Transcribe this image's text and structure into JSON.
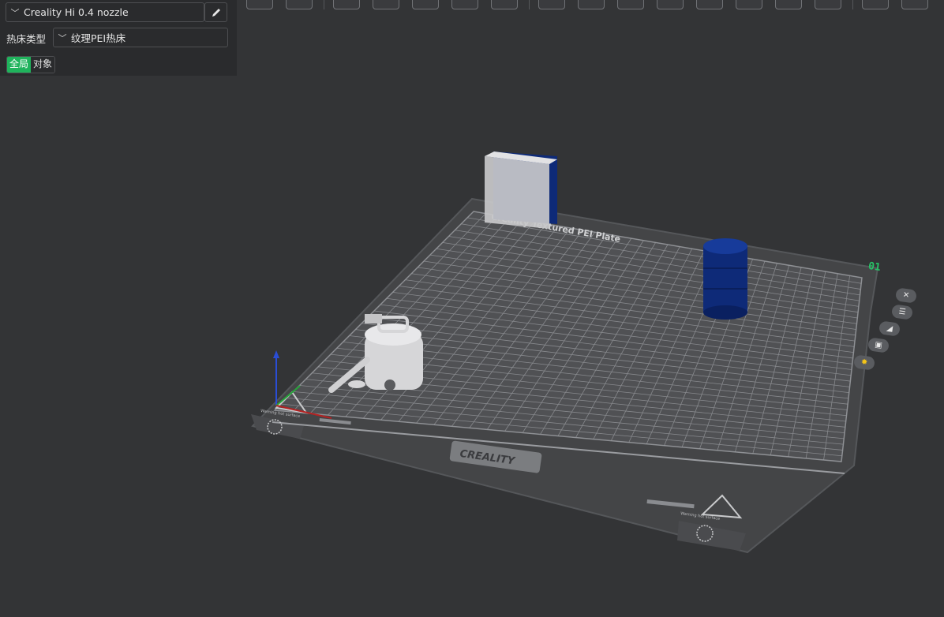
{
  "left_panel": {
    "printer": {
      "value": "Creality Hi 0.4 nozzle"
    },
    "bed_type": {
      "label": "热床类型",
      "value": "纹理PEI热床"
    },
    "mode_tabs": {
      "global": "全局",
      "object": "对象"
    }
  },
  "plate": {
    "top_text": "Creality Textured PEI Plate",
    "brand_text": "CREALITY",
    "warning_text": "Warning hot surface",
    "plate_number": "01"
  },
  "plate_controls": [
    {
      "name": "close-plate-icon"
    },
    {
      "name": "arrange-icon"
    },
    {
      "name": "orient-icon"
    },
    {
      "name": "lock-icon"
    },
    {
      "name": "settings-gear-icon"
    }
  ],
  "colors": {
    "background": "#333436",
    "panel": "#2a2b2d",
    "accent_green": "#1fb35c",
    "plate_number_green": "#27c267",
    "model_blue": "#0e2a78",
    "model_gray": "#d6d6d6"
  }
}
